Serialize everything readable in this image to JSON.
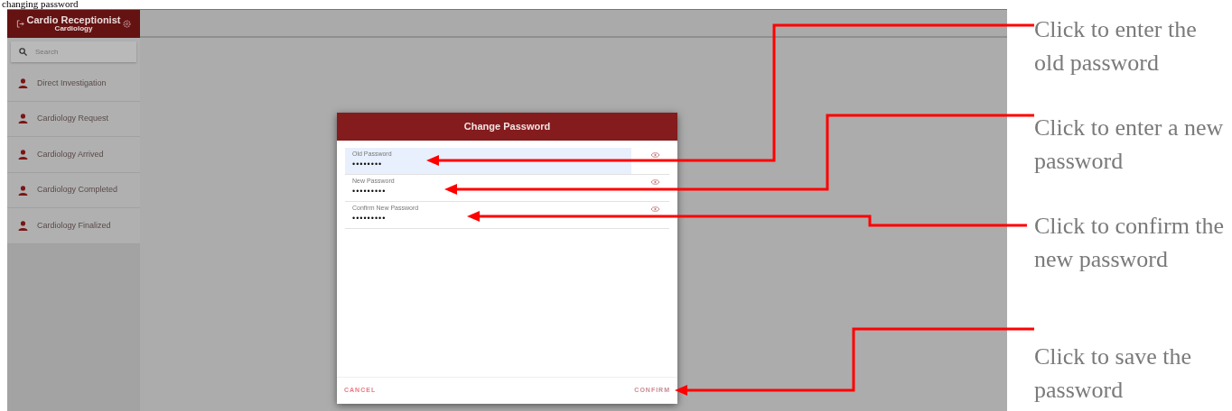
{
  "document_heading": "changing password",
  "app": {
    "header": {
      "title": "Cardio Receptionist",
      "subtitle": "Cardiology"
    },
    "search": {
      "placeholder": "Search"
    },
    "sidebar": {
      "items": [
        {
          "label": "Direct Investigation"
        },
        {
          "label": "Cardiology Request"
        },
        {
          "label": "Cardiology Arrived"
        },
        {
          "label": "Cardiology Completed"
        },
        {
          "label": "Cardiology Finalized"
        }
      ]
    },
    "dialog": {
      "title": "Change Password",
      "fields": [
        {
          "label": "Old Password",
          "value": "••••••••",
          "focused": true
        },
        {
          "label": "New Password",
          "value": "•••••••••",
          "focused": false
        },
        {
          "label": "Confirm New Password",
          "value": "•••••••••",
          "focused": false
        }
      ],
      "buttons": [
        {
          "label": "CANCEL"
        },
        {
          "label": "CONFIRM"
        }
      ]
    }
  },
  "annotations": [
    {
      "text": "Click to enter the old password"
    },
    {
      "text": "Click to enter a new password"
    },
    {
      "text": "Click to confirm the new password"
    },
    {
      "text": "Click to save the password"
    }
  ]
}
